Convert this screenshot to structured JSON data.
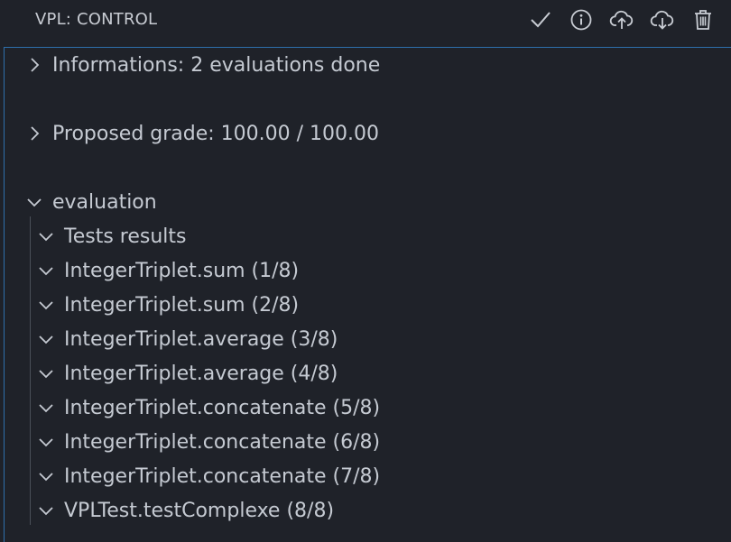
{
  "header": {
    "title": "VPL: CONTROL",
    "actions": [
      {
        "name": "check-icon"
      },
      {
        "name": "info-icon"
      },
      {
        "name": "cloud-upload-icon"
      },
      {
        "name": "cloud-download-icon"
      },
      {
        "name": "trash-icon"
      }
    ]
  },
  "tree": {
    "informations": {
      "label": "Informations: 2 evaluations done",
      "expanded": false
    },
    "grade": {
      "label": "Proposed grade: 100.00 / 100.00",
      "expanded": false
    },
    "evaluation": {
      "label": "evaluation",
      "expanded": true,
      "children": [
        {
          "label": "Tests results"
        },
        {
          "label": "IntegerTriplet.sum (1/8)"
        },
        {
          "label": "IntegerTriplet.sum (2/8)"
        },
        {
          "label": "IntegerTriplet.average (3/8)"
        },
        {
          "label": "IntegerTriplet.average (4/8)"
        },
        {
          "label": "IntegerTriplet.concatenate (5/8)"
        },
        {
          "label": "IntegerTriplet.concatenate (6/8)"
        },
        {
          "label": "IntegerTriplet.concatenate (7/8)"
        },
        {
          "label": "VPLTest.testComplexe (8/8)"
        }
      ]
    }
  },
  "colors": {
    "background": "#1f2229",
    "focus_border": "#2e6fab",
    "text": "#c5cad2"
  }
}
